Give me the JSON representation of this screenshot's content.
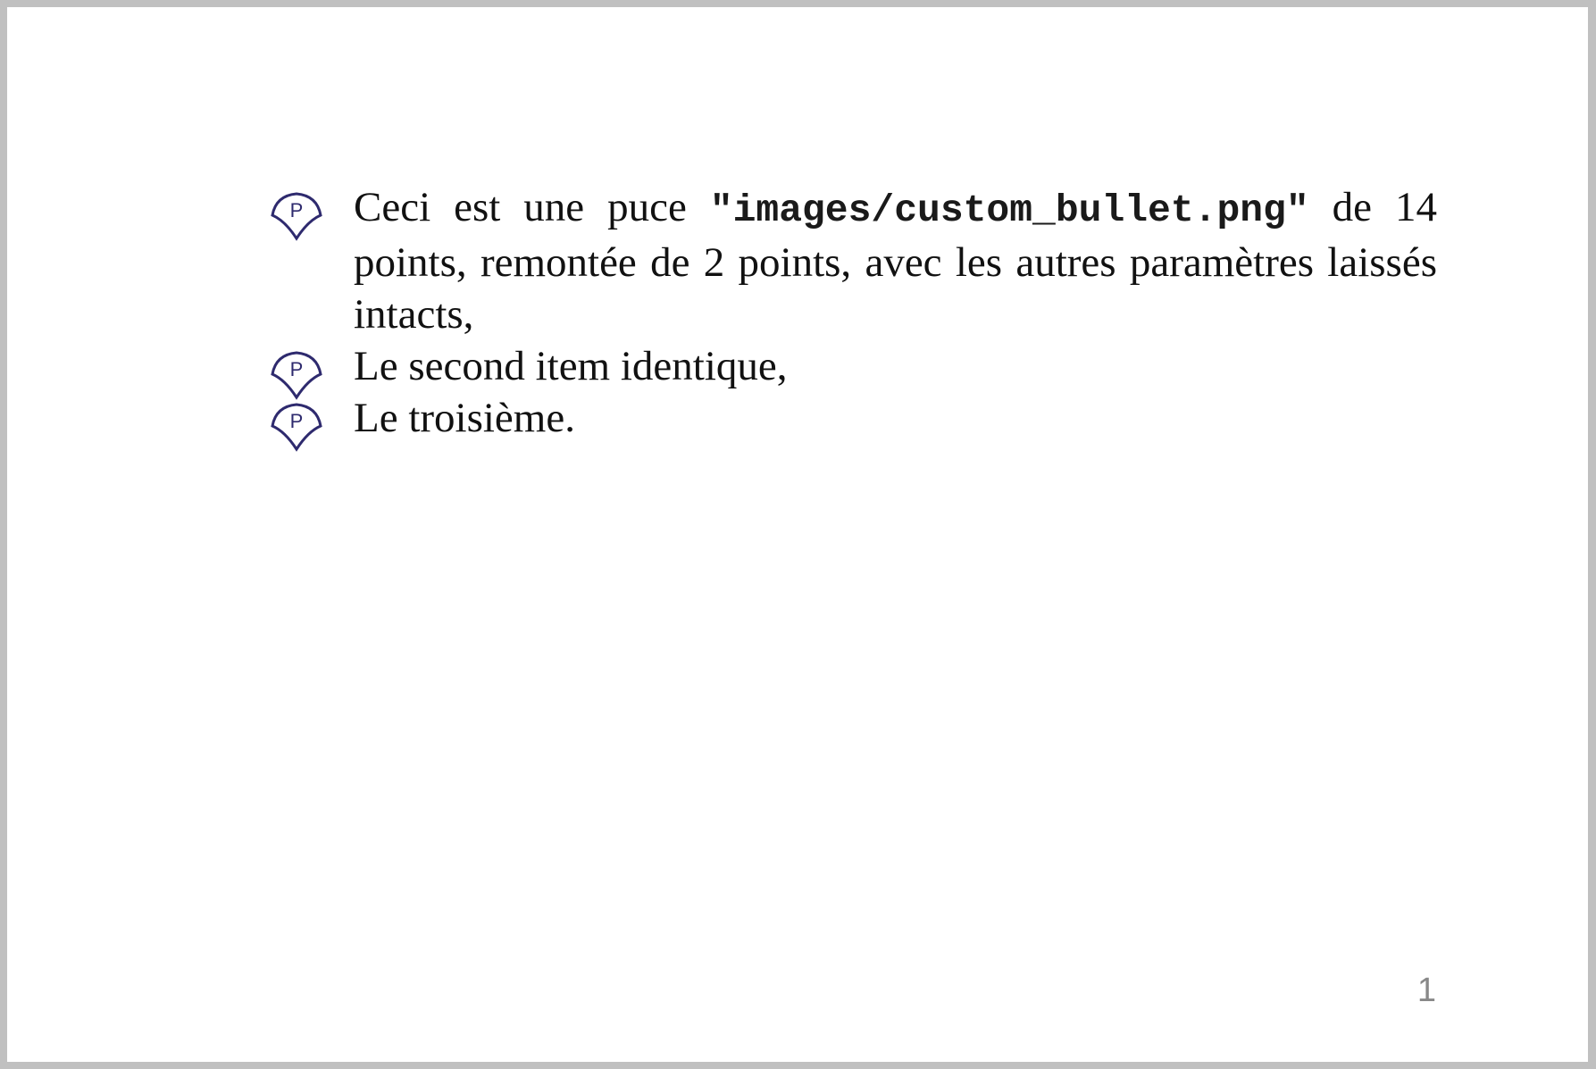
{
  "list": {
    "items": [
      {
        "text_before": "Ceci est une puce ",
        "code": "\"images/custom_bullet.png\"",
        "text_after": " de 14 points, remontée de 2 points, avec les autres paramètres laissés intacts,"
      },
      {
        "text": "Le second item identique,"
      },
      {
        "text": "Le troisième."
      }
    ],
    "bullet": {
      "icon": "custom-bullet-icon",
      "glyph": "P",
      "color": "#2e2a6e"
    }
  },
  "footer": {
    "page_number": "1"
  }
}
